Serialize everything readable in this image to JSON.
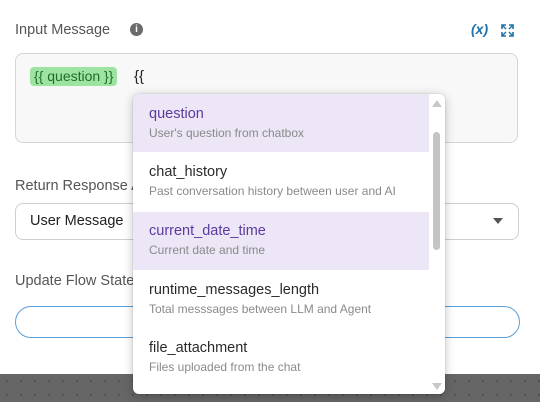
{
  "input_message": {
    "label": "Input Message",
    "info_icon": "info-icon",
    "variable_icon_text": "(x)",
    "chip_text": "{{ question }}",
    "typed_text": "{{"
  },
  "return_response": {
    "label": "Return Response A",
    "selected_value": "User Message"
  },
  "update_flow_state": {
    "label": "Update Flow State"
  },
  "dropdown": {
    "options": [
      {
        "title": "question",
        "description": "User's question from chatbox",
        "highlighted": true
      },
      {
        "title": "chat_history",
        "description": "Past conversation history between user and AI",
        "highlighted": false
      },
      {
        "title": "current_date_time",
        "description": "Current date and time",
        "highlighted": true
      },
      {
        "title": "runtime_messages_length",
        "description": "Total messsages between LLM and Agent",
        "highlighted": false
      },
      {
        "title": "file_attachment",
        "description": "Files uploaded from the chat",
        "highlighted": false
      }
    ]
  },
  "colors": {
    "accent": "#5b3a9e",
    "highlight_bg": "#ece6f6",
    "chip_bg": "#9fe3a2",
    "link_blue": "#1a73a8"
  }
}
